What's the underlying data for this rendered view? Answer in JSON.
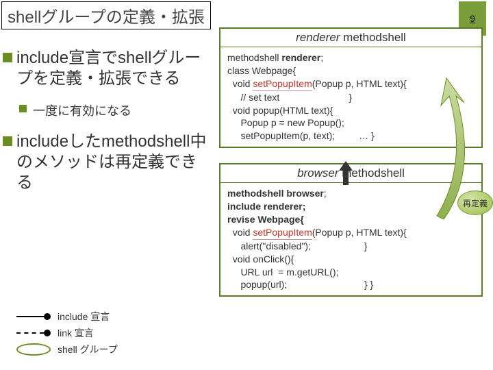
{
  "title": "shellグループの定義・拡張",
  "page_number": "9",
  "bullets": {
    "b1": "include宣言でshellグループを定義・拡張できる",
    "b1_sub": "一度に有効になる",
    "b2": "includeしたmethodshell中のメソッドは再定義できる"
  },
  "code_top": {
    "title_em": "renderer",
    "title_plain": " methodshell",
    "line1_a": "methodshell ",
    "line1_b": "renderer",
    "line1_c": ";",
    "line2": "class Webpage{",
    "line3_a": "  void ",
    "line3_b": "setPopupItem",
    "line3_c": "(Popup p, HTML text){",
    "line4": "     // set text                          }",
    "line5": "  void popup(HTML text){",
    "line6": "     Popup p = new Popup();",
    "line7": "     setPopupItem(p, text);         … }"
  },
  "code_bottom": {
    "title_em": "browser",
    "title_plain": " methodshell",
    "line1_a": "methodshell ",
    "line1_b": "browser",
    "line1_c": ";",
    "line2_a": "include ",
    "line2_b": "renderer;",
    "line3": "revise Webpage{",
    "line4_a": "  void ",
    "line4_b": "setPopupItem",
    "line4_c": "(Popup p, HTML text){",
    "line5": "     alert(\"disabled\");                    }",
    "line6": "  void onClick(){",
    "line7": "     URL url  = m.getURL();",
    "line8": "     popup(url);                             } }"
  },
  "badge": "再定義",
  "legend": {
    "include": "include 宣言",
    "link": "link 宣言",
    "shell": "shell グループ"
  }
}
